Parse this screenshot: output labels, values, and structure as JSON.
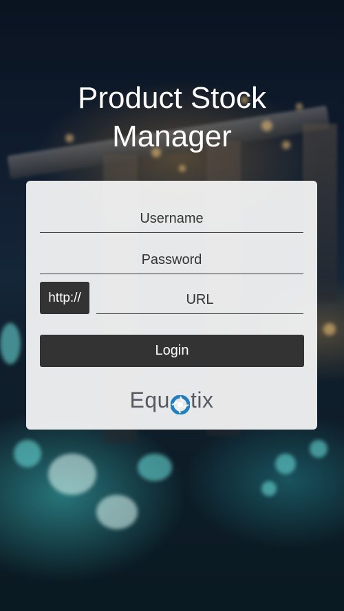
{
  "app": {
    "title_line1": "Product Stock",
    "title_line2": "Manager"
  },
  "form": {
    "username_placeholder": "Username",
    "password_placeholder": "Password",
    "url_prefix": "http://",
    "url_placeholder": "URL",
    "login_label": "Login"
  },
  "brand": {
    "logo_text_left": "Equ",
    "logo_text_right": "tix",
    "logo_icon": "aperture-icon",
    "logo_icon_color": "#1f7fbf",
    "text_color": "#555a62"
  },
  "colors": {
    "button_bg": "#333333",
    "card_bg": "#f8f8f8"
  }
}
